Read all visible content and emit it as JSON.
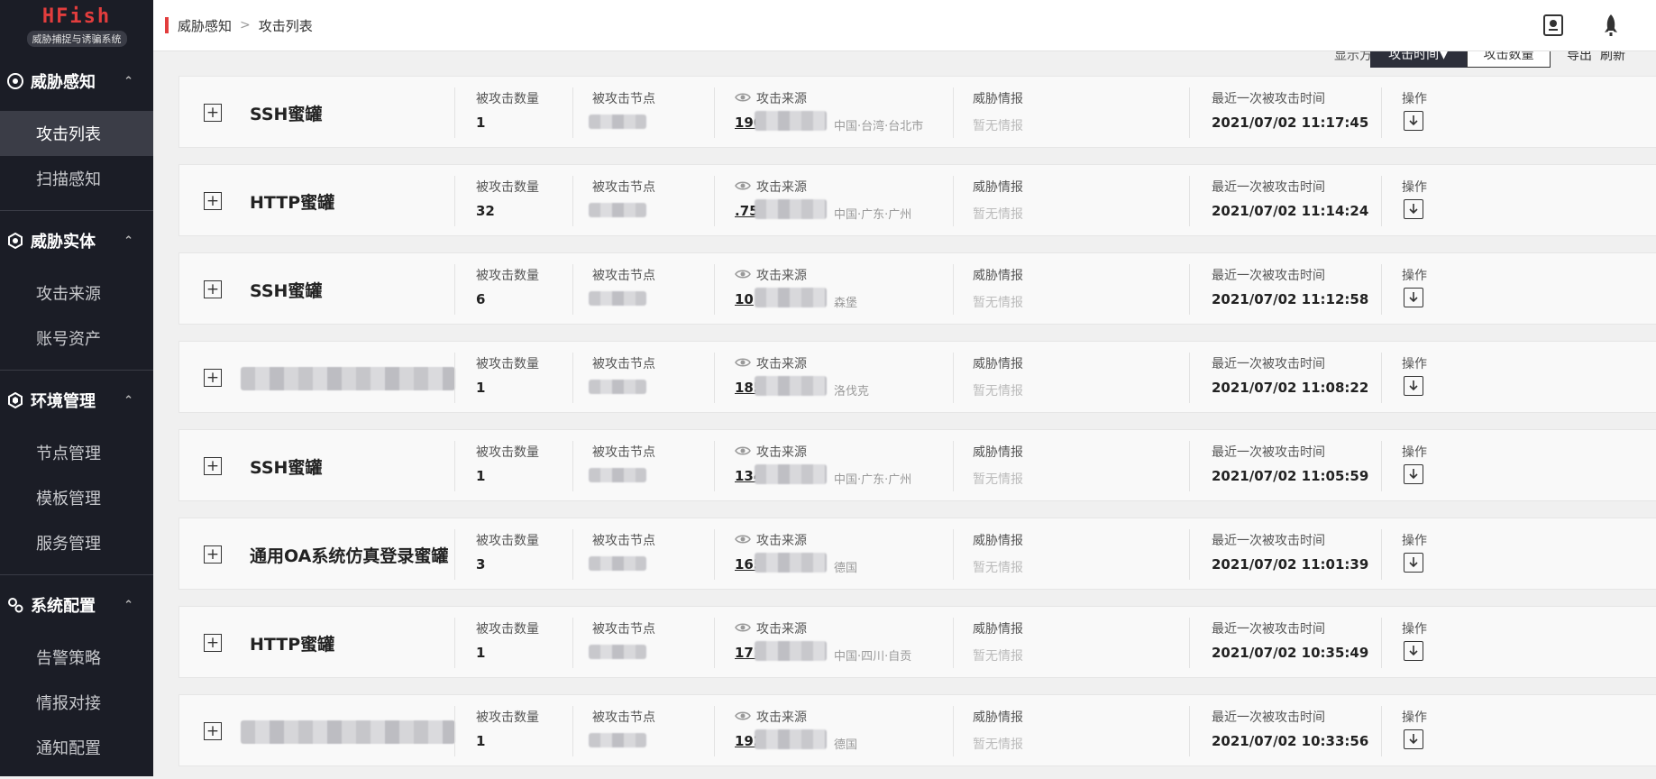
{
  "app": {
    "title": "HFish",
    "subtitle": "威胁捕捉与诱骗系统"
  },
  "sidebar": {
    "groups": [
      {
        "label": "威胁感知",
        "icon": "radar-icon",
        "items": [
          {
            "label": "攻击列表",
            "active": true
          },
          {
            "label": "扫描感知"
          }
        ]
      },
      {
        "label": "威胁实体",
        "icon": "entity-icon",
        "items": [
          {
            "label": "攻击来源"
          },
          {
            "label": "账号资产"
          }
        ]
      },
      {
        "label": "环境管理",
        "icon": "environment-icon",
        "items": [
          {
            "label": "节点管理"
          },
          {
            "label": "模板管理"
          },
          {
            "label": "服务管理"
          }
        ]
      },
      {
        "label": "系统配置",
        "icon": "settings-icon",
        "items": [
          {
            "label": "告警策略"
          },
          {
            "label": "情报对接"
          },
          {
            "label": "通知配置"
          }
        ]
      }
    ]
  },
  "breadcrumb": {
    "root": "威胁感知",
    "current": "攻击列表"
  },
  "toolbar": {
    "sort_label": "显示方式：",
    "sort_active": "攻击时间",
    "sort_inactive": "攻击数量",
    "export": "导出",
    "refresh": "刷新"
  },
  "columns": {
    "count": "被攻击数量",
    "node": "被攻击节点",
    "source": "攻击来源",
    "intel": "威胁情报",
    "last_time": "最近一次被攻击时间",
    "action": "操作"
  },
  "rows": [
    {
      "name": "SSH蜜罐",
      "count": "1",
      "ip": "190",
      "region": "中国·台湾·台北市",
      "intel": "暂无情报",
      "time": "2021/07/02 11:17:45"
    },
    {
      "name": "HTTP蜜罐",
      "count": "32",
      "ip": ".75",
      "region": "中国·广东·广州",
      "intel": "暂无情报",
      "time": "2021/07/02 11:14:24"
    },
    {
      "name": "SSH蜜罐",
      "count": "6",
      "ip": "10",
      "region": "森堡",
      "intel": "暂无情报",
      "time": "2021/07/02 11:12:58"
    },
    {
      "name": "",
      "count": "1",
      "ip": "185",
      "region": "洛伐克",
      "intel": "暂无情报",
      "time": "2021/07/02 11:08:22"
    },
    {
      "name": "SSH蜜罐",
      "count": "1",
      "ip": "134.",
      "region": "中国·广东·广州",
      "intel": "暂无情报",
      "time": "2021/07/02 11:05:59"
    },
    {
      "name": "通用OA系统仿真登录蜜罐",
      "count": "3",
      "ip": "165.22",
      "region": "德国",
      "intel": "暂无情报",
      "time": "2021/07/02 11:01:39"
    },
    {
      "name": "HTTP蜜罐",
      "count": "1",
      "ip": "171.94",
      "region": "中国·四川·自贡",
      "intel": "暂无情报",
      "time": "2021/07/02 10:35:49"
    },
    {
      "name": "",
      "count": "1",
      "ip": "192.24",
      "region": "德国",
      "intel": "暂无情报",
      "time": "2021/07/02 10:33:56"
    }
  ]
}
